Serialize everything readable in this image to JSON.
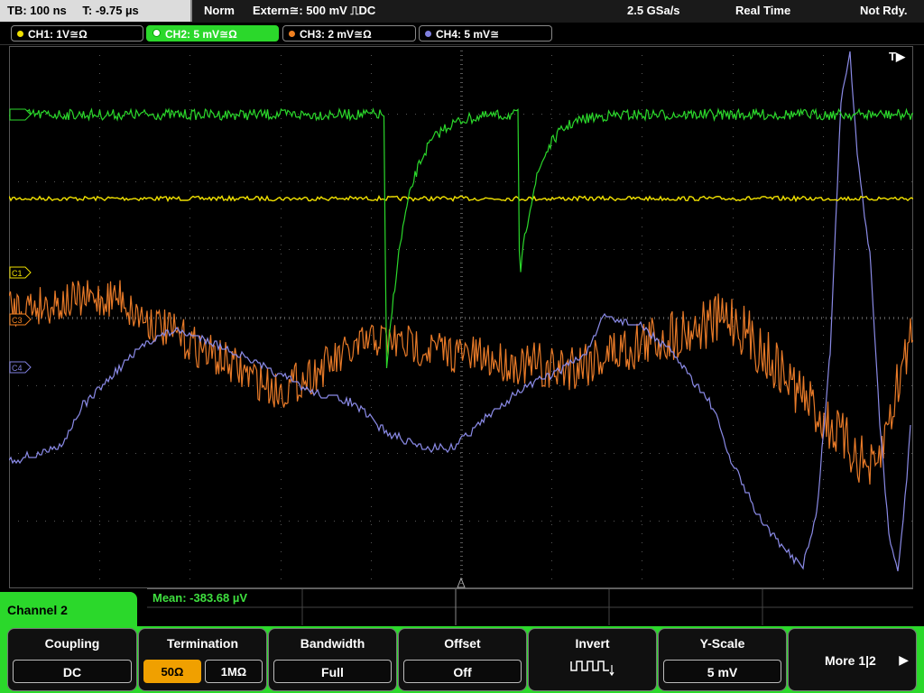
{
  "top": {
    "timebase": "TB: 100 ns",
    "trigger_time": "T: -9.75 µs",
    "mode": "Norm",
    "trigger_source": "Extern≅: 500 mV ⎍DC",
    "sample_rate": "2.5 GSa/s",
    "acq_mode": "Real Time",
    "status": "Not Rdy."
  },
  "channels": [
    {
      "label": "CH1: 1V≅Ω",
      "color": "#f0e000"
    },
    {
      "label": "CH2: 5 mV≅Ω",
      "color": "#2bd82b"
    },
    {
      "label": "CH3: 2 mV≅Ω",
      "color": "#f08020"
    },
    {
      "label": "CH4: 5 mV≅",
      "color": "#8080e0"
    }
  ],
  "markers": {
    "trigger": "T▶",
    "c1": "C1",
    "c3": "C3",
    "c4": "C4"
  },
  "measurement": {
    "text": "Mean: -383.68 µV"
  },
  "channel_menu": {
    "title": "Channel 2"
  },
  "softkeys": {
    "coupling": {
      "title": "Coupling",
      "value": "DC"
    },
    "termination": {
      "title": "Termination",
      "opt1": "50Ω",
      "opt2": "1MΩ",
      "selected": "50Ω"
    },
    "bandwidth": {
      "title": "Bandwidth",
      "value": "Full"
    },
    "offset": {
      "title": "Offset",
      "value": "Off"
    },
    "invert": {
      "title": "Invert",
      "icon": "invert-square-wave-icon"
    },
    "yscale": {
      "title": "Y-Scale",
      "value": "5 mV"
    },
    "more": {
      "label": "More 1|2",
      "icon": "right-arrow-icon"
    }
  }
}
